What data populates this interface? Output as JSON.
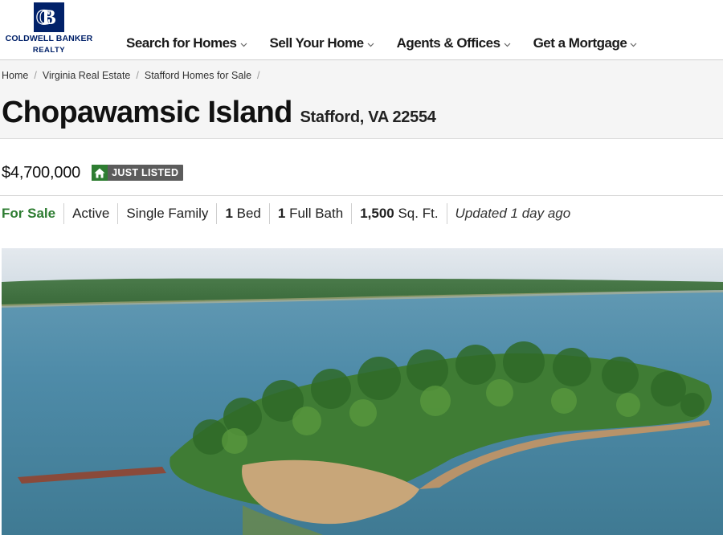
{
  "brand": {
    "name_line1": "COLDWELL BANKER",
    "name_line2": "REALTY",
    "color": "#012169"
  },
  "nav": {
    "items": [
      {
        "label": "Search for Homes"
      },
      {
        "label": "Sell Your Home"
      },
      {
        "label": "Agents & Offices"
      },
      {
        "label": "Get a Mortgage"
      }
    ],
    "chevron_icon": "chevron-down-icon"
  },
  "breadcrumb": [
    {
      "label": "Home"
    },
    {
      "label": "Virginia Real Estate"
    },
    {
      "label": "Stafford Homes for Sale"
    }
  ],
  "listing": {
    "title": "Chopawamsic Island",
    "location": "Stafford, VA 22554",
    "price": "$4,700,000",
    "badge": {
      "label": "JUST LISTED",
      "icon": "home-icon",
      "icon_color": "#2e7d32"
    },
    "facts": {
      "status": "For Sale",
      "state": "Active",
      "type": "Single Family",
      "beds_count": "1",
      "beds_label": "Bed",
      "baths_count": "1",
      "baths_label": "Full Bath",
      "sqft_count": "1,500",
      "sqft_label": "Sq. Ft.",
      "updated": "Updated 1 day ago"
    },
    "status_color": "#2e7d32"
  }
}
